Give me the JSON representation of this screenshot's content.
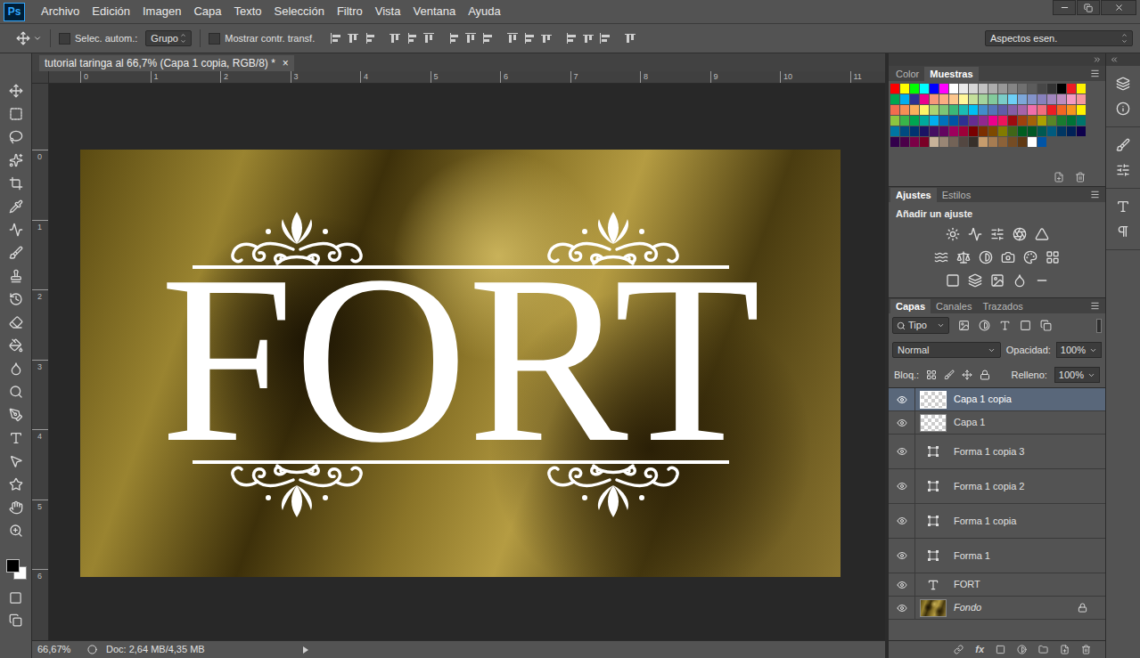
{
  "app": {
    "logo": "Ps"
  },
  "menu": [
    "Archivo",
    "Edición",
    "Imagen",
    "Capa",
    "Texto",
    "Selección",
    "Filtro",
    "Vista",
    "Ventana",
    "Ayuda"
  ],
  "options_bar": {
    "auto_select": {
      "label": "Selec. autom.:",
      "checked": false
    },
    "auto_select_mode": "Grupo",
    "show_transform": {
      "label": "Mostrar contr. transf.",
      "checked": false
    },
    "workspace": "Aspectos esen."
  },
  "document_tab": {
    "title": "tutorial taringa al 66,7% (Capa 1 copia, RGB/8) *",
    "close": "×"
  },
  "rulers": {
    "horizontal": [
      "0",
      "1",
      "2",
      "3",
      "4",
      "5",
      "6",
      "7",
      "8",
      "9",
      "10",
      "11"
    ],
    "vertical": [
      "0",
      "1",
      "2",
      "3",
      "4",
      "5",
      "6"
    ]
  },
  "canvas": {
    "text": "FORT"
  },
  "status_bar": {
    "zoom": "66,67%",
    "doc": "Doc: 2,64 MB/4,35 MB"
  },
  "swatches_panel": {
    "tabs": [
      {
        "label": "Color",
        "selected": false
      },
      {
        "label": "Muestras",
        "selected": true
      }
    ],
    "swatches": [
      {
        "color": "#ff0000"
      },
      {
        "color": "#ffff00"
      },
      {
        "color": "#00ff00"
      },
      {
        "color": "#00ffff"
      },
      {
        "color": "#0000ff"
      },
      {
        "color": "#ff00ff"
      },
      {
        "color": "#ffffff"
      },
      {
        "color": "#ebebeb"
      },
      {
        "color": "#d6d6d6"
      },
      {
        "color": "#c2c2c2"
      },
      {
        "color": "#adadad"
      },
      {
        "color": "#999999"
      },
      {
        "color": "#858585"
      },
      {
        "color": "#707070"
      },
      {
        "color": "#5c5c5c"
      },
      {
        "color": "#474747"
      },
      {
        "color": "#333333"
      },
      {
        "color": "#000000"
      },
      {
        "color": "#ed1c24"
      },
      {
        "color": "#fff200"
      },
      {
        "color": "#00a651"
      },
      {
        "color": "#00aeef"
      },
      {
        "color": "#2e3192"
      },
      {
        "color": "#ec008c"
      },
      {
        "color": "#f7977a"
      },
      {
        "color": "#fbad82"
      },
      {
        "color": "#fdc68c"
      },
      {
        "color": "#fff799"
      },
      {
        "color": "#c4df9b"
      },
      {
        "color": "#a3d39c"
      },
      {
        "color": "#82ca9c"
      },
      {
        "color": "#7accc8"
      },
      {
        "color": "#6dcff6"
      },
      {
        "color": "#7da7d9"
      },
      {
        "color": "#8393ca"
      },
      {
        "color": "#8781bd"
      },
      {
        "color": "#a186be"
      },
      {
        "color": "#bd8cbf"
      },
      {
        "color": "#f49ac1"
      },
      {
        "color": "#f5989d"
      },
      {
        "color": "#f26c4f"
      },
      {
        "color": "#f68e55"
      },
      {
        "color": "#fbaf5c"
      },
      {
        "color": "#fff467"
      },
      {
        "color": "#acd372"
      },
      {
        "color": "#7cc576"
      },
      {
        "color": "#3bb878"
      },
      {
        "color": "#1abbb4"
      },
      {
        "color": "#00bff3"
      },
      {
        "color": "#438ccb"
      },
      {
        "color": "#5574b9"
      },
      {
        "color": "#605ca8"
      },
      {
        "color": "#855fa8"
      },
      {
        "color": "#a763a8"
      },
      {
        "color": "#f06eaa"
      },
      {
        "color": "#f26d7d"
      },
      {
        "color": "#ed1c24"
      },
      {
        "color": "#f26522"
      },
      {
        "color": "#f7941d"
      },
      {
        "color": "#fff200"
      },
      {
        "color": "#8dc63f"
      },
      {
        "color": "#39b54a"
      },
      {
        "color": "#00a651"
      },
      {
        "color": "#00a99d"
      },
      {
        "color": "#00aeef"
      },
      {
        "color": "#0072bc"
      },
      {
        "color": "#0054a6"
      },
      {
        "color": "#2e3192"
      },
      {
        "color": "#662d91"
      },
      {
        "color": "#92278f"
      },
      {
        "color": "#ec008c"
      },
      {
        "color": "#ed145b"
      },
      {
        "color": "#9e0b0f"
      },
      {
        "color": "#a0410d"
      },
      {
        "color": "#a36209"
      },
      {
        "color": "#aba000"
      },
      {
        "color": "#598527"
      },
      {
        "color": "#197b30"
      },
      {
        "color": "#007236"
      },
      {
        "color": "#00746b"
      },
      {
        "color": "#0076a3"
      },
      {
        "color": "#004b80"
      },
      {
        "color": "#003471"
      },
      {
        "color": "#1b1464"
      },
      {
        "color": "#440e62"
      },
      {
        "color": "#630460"
      },
      {
        "color": "#9e005d"
      },
      {
        "color": "#9e0039"
      },
      {
        "color": "#790000"
      },
      {
        "color": "#7b2e00"
      },
      {
        "color": "#7d4900"
      },
      {
        "color": "#827b00"
      },
      {
        "color": "#406618"
      },
      {
        "color": "#005e20"
      },
      {
        "color": "#005826"
      },
      {
        "color": "#005952"
      },
      {
        "color": "#005b7f"
      },
      {
        "color": "#003663"
      },
      {
        "color": "#002157"
      },
      {
        "color": "#0d004c"
      },
      {
        "color": "#32004b"
      },
      {
        "color": "#4b0049"
      },
      {
        "color": "#7b0046"
      },
      {
        "color": "#7a0026"
      },
      {
        "color": "#c7b299"
      },
      {
        "color": "#998675"
      },
      {
        "color": "#736357"
      },
      {
        "color": "#534741"
      },
      {
        "color": "#37302a"
      },
      {
        "color": "#c69c6d"
      },
      {
        "color": "#a67c52"
      },
      {
        "color": "#8c6239"
      },
      {
        "color": "#754c24"
      },
      {
        "color": "#603913"
      },
      {
        "color": "#ffffff"
      },
      {
        "color": "#0054a6"
      }
    ]
  },
  "adjustments_panel": {
    "tabs": [
      {
        "label": "Ajustes",
        "selected": true
      },
      {
        "label": "Estilos",
        "selected": false
      }
    ],
    "heading": "Añadir un ajuste"
  },
  "layers_panel": {
    "tabs": [
      {
        "label": "Capas",
        "selected": true
      },
      {
        "label": "Canales",
        "selected": false
      },
      {
        "label": "Trazados",
        "selected": false
      }
    ],
    "filter": "Tipo",
    "blend_mode": "Normal",
    "opacity_label": "Opacidad:",
    "opacity": "100%",
    "lock_label": "Bloq.:",
    "fill_label": "Relleno:",
    "fill": "100%",
    "fx_label": "fx",
    "layers": [
      {
        "name": "Capa 1 copia",
        "kind": "pixel",
        "selected": true,
        "visible": true,
        "locked": false
      },
      {
        "name": "Capa 1",
        "kind": "pixel",
        "selected": false,
        "visible": true,
        "locked": false
      },
      {
        "name": "Forma 1 copia 3",
        "kind": "shape",
        "selected": false,
        "visible": true,
        "locked": false
      },
      {
        "name": "Forma 1 copia 2",
        "kind": "shape",
        "selected": false,
        "visible": true,
        "locked": false
      },
      {
        "name": "Forma 1 copia",
        "kind": "shape",
        "selected": false,
        "visible": true,
        "locked": false
      },
      {
        "name": "Forma 1",
        "kind": "shape",
        "selected": false,
        "visible": true,
        "locked": false
      },
      {
        "name": "FORT",
        "kind": "text",
        "selected": false,
        "visible": true,
        "locked": false
      },
      {
        "name": "Fondo",
        "kind": "background",
        "selected": false,
        "visible": true,
        "locked": true
      }
    ]
  }
}
